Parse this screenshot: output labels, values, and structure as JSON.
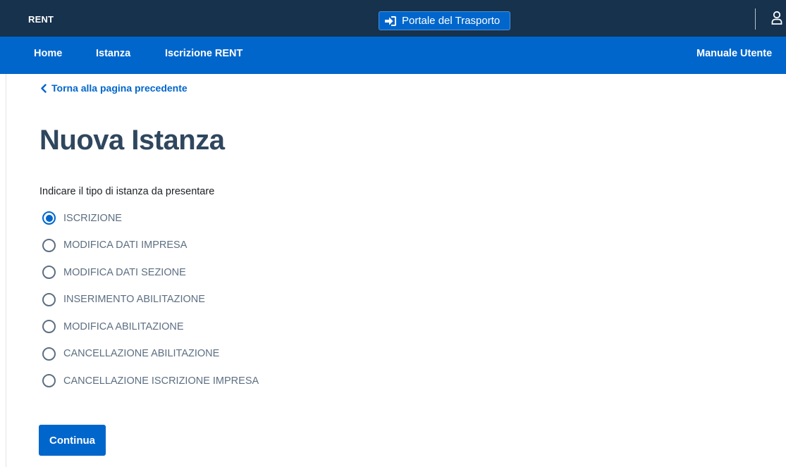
{
  "header": {
    "brand": "RENT",
    "portal_button": "Portale del Trasporto",
    "portal_icon": "sign-in-icon",
    "user_icon": "user-icon"
  },
  "nav": {
    "items": [
      "Home",
      "Istanza",
      "Iscrizione RENT"
    ],
    "manual": "Manuale Utente"
  },
  "main": {
    "back_link": "Torna alla pagina precedente",
    "title": "Nuova Istanza",
    "question": "Indicare il tipo di istanza da presentare",
    "options": [
      "ISCRIZIONE",
      "MODIFICA DATI IMPRESA",
      "MODIFICA DATI SEZIONE",
      "INSERIMENTO ABILITAZIONE",
      "MODIFICA ABILITAZIONE",
      "CANCELLAZIONE ABILITAZIONE",
      "CANCELLAZIONE ISCRIZIONE IMPRESA"
    ],
    "selected_option": "ISCRIZIONE",
    "continue_button": "Continua"
  },
  "colors": {
    "topbar": "#17324d",
    "primary": "#0066cc",
    "title": "#2f475e"
  }
}
